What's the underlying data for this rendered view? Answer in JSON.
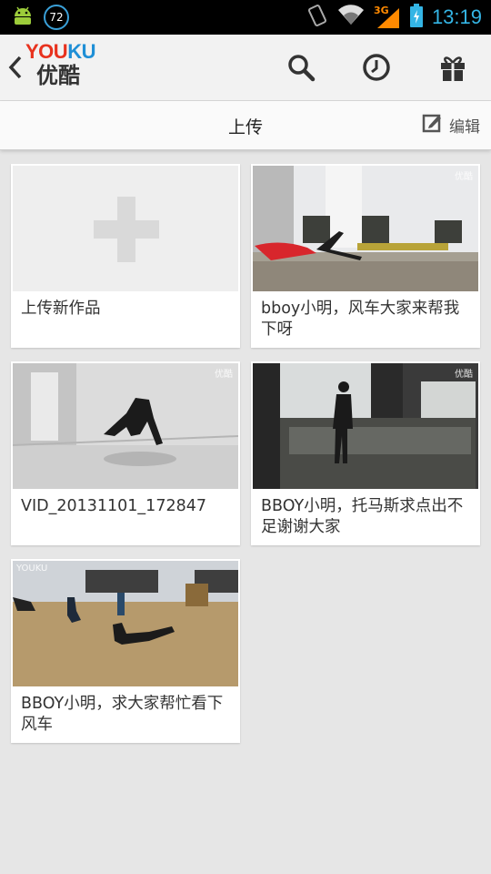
{
  "status_bar": {
    "notification_count": "72",
    "network": "3G",
    "time": "13:19"
  },
  "app_bar": {
    "logo_en": "YOUKU",
    "logo_cn": "优酷",
    "icons": [
      "back-icon",
      "search-icon",
      "history-icon",
      "gift-icon"
    ]
  },
  "title_bar": {
    "title": "上传",
    "edit_label": "编辑"
  },
  "watermark": "优酷",
  "watermark_en": "YOUKU",
  "cards": [
    {
      "caption": "上传新作品",
      "type": "upload"
    },
    {
      "caption": "bboy小明，风车大家来帮我下呀"
    },
    {
      "caption": "VID_20131101_172847"
    },
    {
      "caption": "BBOY小明，托马斯求点出不足谢谢大家"
    },
    {
      "caption": "BBOY小明，求大家帮忙看下风车"
    }
  ]
}
